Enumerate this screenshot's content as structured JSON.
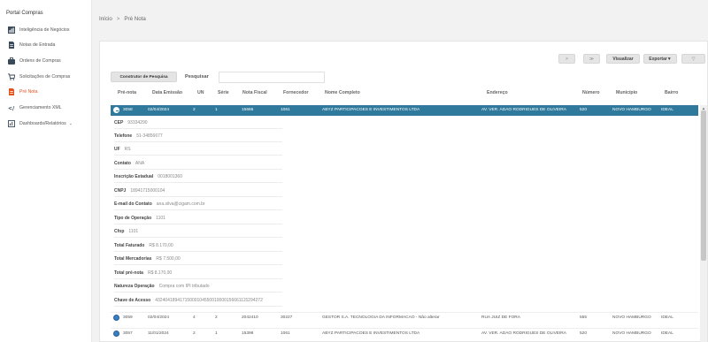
{
  "sidebar": {
    "title": "Portal Compras",
    "items": [
      {
        "label": "Inteligência de Negócios",
        "icon": "chart-icon"
      },
      {
        "label": "Notas de Entrada",
        "icon": "document-icon"
      },
      {
        "label": "Ordens de Compras",
        "icon": "briefcase-icon"
      },
      {
        "label": "Solicitações de Compras",
        "icon": "cart-icon"
      },
      {
        "label": "Pré Nota",
        "icon": "invoice-icon",
        "active": true
      },
      {
        "label": "Gerenciamento XML",
        "icon": "xml-icon"
      },
      {
        "label": "Dashboards/Relatórios",
        "icon": "dashboard-icon"
      }
    ]
  },
  "breadcrumb": {
    "home": "Início",
    "separator": ">",
    "current": "Pré Nota"
  },
  "toolbar": {
    "next": ">",
    "last": "≫",
    "visualizar": "Visualizar",
    "exportar": "Exportar▼",
    "more": "▽"
  },
  "query": {
    "builder_label": "Construtor de Pesquisa",
    "search_label": "Pesquisar",
    "search_value": ""
  },
  "table": {
    "headers": [
      "Pré-nota",
      "Data Emissão",
      "UN",
      "Série",
      "Nota Fiscal",
      "Fornecedor",
      "Nome Completo",
      "Endereço",
      "Número",
      "Município",
      "Bairro"
    ],
    "rows": [
      {
        "prenota": "3058",
        "data": "02/04/2024",
        "un": "2",
        "serie": "1",
        "nf": "15666",
        "fornecedor": "1061",
        "nome": "ABYZ PARTICIPACOES E INVESTIMENTOS LTDA",
        "endereco": "AV. VER. ADAO RODRIGUES DE OLIVEIRA",
        "numero": "520",
        "municipio": "NOVO HAMBURGO",
        "bairro": "IDEAL"
      },
      {
        "prenota": "3059",
        "data": "02/04/2024",
        "un": "4",
        "serie": "2",
        "nf": "2042410",
        "fornecedor": "30227",
        "nome": "GESTOR S.A. TECNOLOGIA DA INFORMACAO - Não alterar",
        "endereco": "RUA JUIZ DE FORA",
        "numero": "555",
        "municipio": "NOVO HAMBURGO",
        "bairro": "IDEAL"
      },
      {
        "prenota": "3057",
        "data": "11/01/2024",
        "un": "2",
        "serie": "1",
        "nf": "15398",
        "fornecedor": "1061",
        "nome": "ABYZ PARTICIPACOES E INVESTIMENTOS LTDA",
        "endereco": "AV. VER. ADAO RODRIGUES DE OLIVEIRA",
        "numero": "520",
        "municipio": "NOVO HAMBURGO",
        "bairro": "IDEAL"
      }
    ]
  },
  "detail": [
    {
      "label": "CEP",
      "value": "93334290"
    },
    {
      "label": "Telefone",
      "value": "51-34856677"
    },
    {
      "label": "UF",
      "value": "RS"
    },
    {
      "label": "Contato",
      "value": "ANA"
    },
    {
      "label": "Inscrição Estadual",
      "value": "0018001360"
    },
    {
      "label": "CNPJ",
      "value": "18941715000104"
    },
    {
      "label": "E-mail do Contato",
      "value": "ana.silva@cigam.com.br"
    },
    {
      "label": "Tipo de Operação",
      "value": "1101"
    },
    {
      "label": "Cfop",
      "value": "1101"
    },
    {
      "label": "Total Faturado",
      "value": "R$ 8.170,00"
    },
    {
      "label": "Total Mercadorias",
      "value": "R$ 7.500,00"
    },
    {
      "label": "Total pré-nota",
      "value": "R$ 8.170,00"
    },
    {
      "label": "Natureza Operação",
      "value": "Compra com IPI tributado"
    },
    {
      "label": "Chave de Acesso",
      "value": "43240418941715000104550010000156661115294272"
    }
  ]
}
